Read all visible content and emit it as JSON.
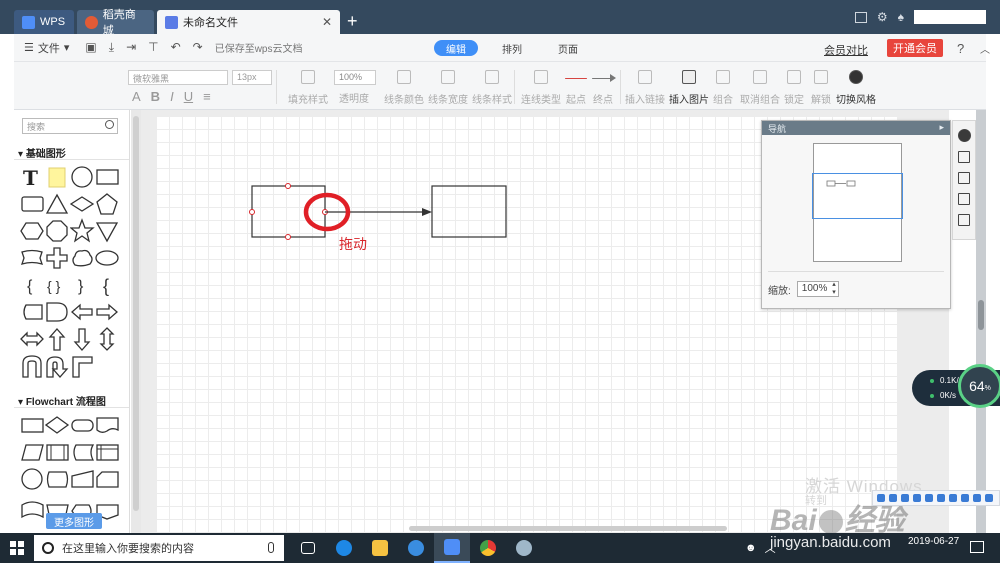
{
  "tabs": [
    {
      "label": "WPS"
    },
    {
      "label": "稻壳商城"
    },
    {
      "label": "未命名文件"
    }
  ],
  "new_tab": "+",
  "menu": {
    "file": "文件",
    "saved": "已保存至wps云文档",
    "modes": [
      "编辑",
      "排列",
      "页面"
    ],
    "active_mode": "编辑",
    "member_compare": "会员对比",
    "open_vip": "开通会员",
    "help": "?"
  },
  "toolbar": {
    "font_name": "微软雅黑",
    "font_size": "13px",
    "opacity": "100%",
    "buttons": {
      "fill_style": "填充样式",
      "opacity": "透明度",
      "line_color": "线条颜色",
      "line_width": "线条宽度",
      "line_style": "线条样式",
      "connector_type": "连线类型",
      "start_point": "起点",
      "end_point": "终点",
      "insert_link": "插入链接",
      "insert_image": "插入图片",
      "group": "组合",
      "ungroup": "取消组合",
      "lock": "锁定",
      "unlock": "解锁",
      "switch_style": "切换风格"
    }
  },
  "left_panel": {
    "search_placeholder": "搜索",
    "section_basic": "基础图形",
    "section_flowchart": "Flowchart 流程图",
    "more_shapes": "更多图形"
  },
  "canvas": {
    "annotation": "拖动",
    "watermark_line1": "激活 Windows",
    "watermark_line2": "转到"
  },
  "navigator": {
    "title": "导航",
    "zoom_label": "缩放:",
    "zoom_value": "100%"
  },
  "network_widget": {
    "upload": "0.1K/s",
    "download": "0K/s",
    "usage": "64",
    "usage_unit": "%"
  },
  "taskbar": {
    "search_placeholder": "在这里输入你要搜索的内容",
    "time": "2019-06-27"
  },
  "watermark": {
    "site": "jingyan.baidu.com"
  },
  "colors": {
    "accent": "#3f8ff7",
    "vip": "#e8453c",
    "annotation": "#d8262b",
    "titlebar": "#34495e"
  }
}
